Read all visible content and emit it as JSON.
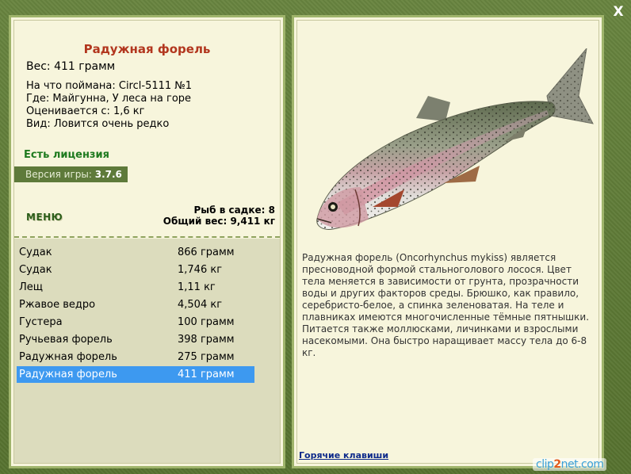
{
  "close_label": "X",
  "fish": {
    "title": "Радужная форель",
    "weight_line": "Вес: 411 грамм",
    "caught_with": "На что поймана: Circl-5111 №1",
    "location": "Где: Майгунна, У леса на горе",
    "value": "Оценивается с: 1,6 кг",
    "rarity": "Вид: Ловится очень редко"
  },
  "license_text": "Есть лицензия",
  "version": {
    "label": "Версия игры:",
    "number": "3.7.6"
  },
  "menu_label": "МЕНЮ",
  "keep": {
    "count_line": "Рыб в садке: 8",
    "total_line": "Общий вес: 9,411 кг"
  },
  "catch_list": [
    {
      "name": "Судак",
      "weight": "866 грамм"
    },
    {
      "name": "Судак",
      "weight": "1,746 кг"
    },
    {
      "name": "Лещ",
      "weight": "1,11 кг"
    },
    {
      "name": "Ржавое ведро",
      "weight": "4,504 кг"
    },
    {
      "name": "Густера",
      "weight": "100 грамм"
    },
    {
      "name": "Ручьевая форель",
      "weight": "398 грамм"
    },
    {
      "name": "Радужная форель",
      "weight": "275 грамм"
    },
    {
      "name": "Радужная форель",
      "weight": "411 грамм"
    }
  ],
  "selected_index": 7,
  "description": "Радужная форель (Oncorhynchus mykiss) является пресноводной формой стальноголового лосося. Цвет тела меняется в зависимости от грунта, прозрачности воды и других факторов среды. Брюшко, как правило, серебристо-белое, а спинка зеленоватая. На теле и плавниках имеются многочисленные тёмные пятнышки. Питается также моллюсками, личинками и взрослыми насекомыми. Она быстро наращивает массу тела до 6-8 кг.",
  "hotkeys_label": "Горячие клавиши",
  "watermark": {
    "part1": "clip",
    "part2": "2",
    "part3": "net",
    "part4": ".com"
  },
  "colors": {
    "frame": "#5f7c3b",
    "panel": "#f7f5dc",
    "list_bg": "#dcdcbd",
    "selected": "#3d99f0",
    "title": "#b2361e"
  }
}
